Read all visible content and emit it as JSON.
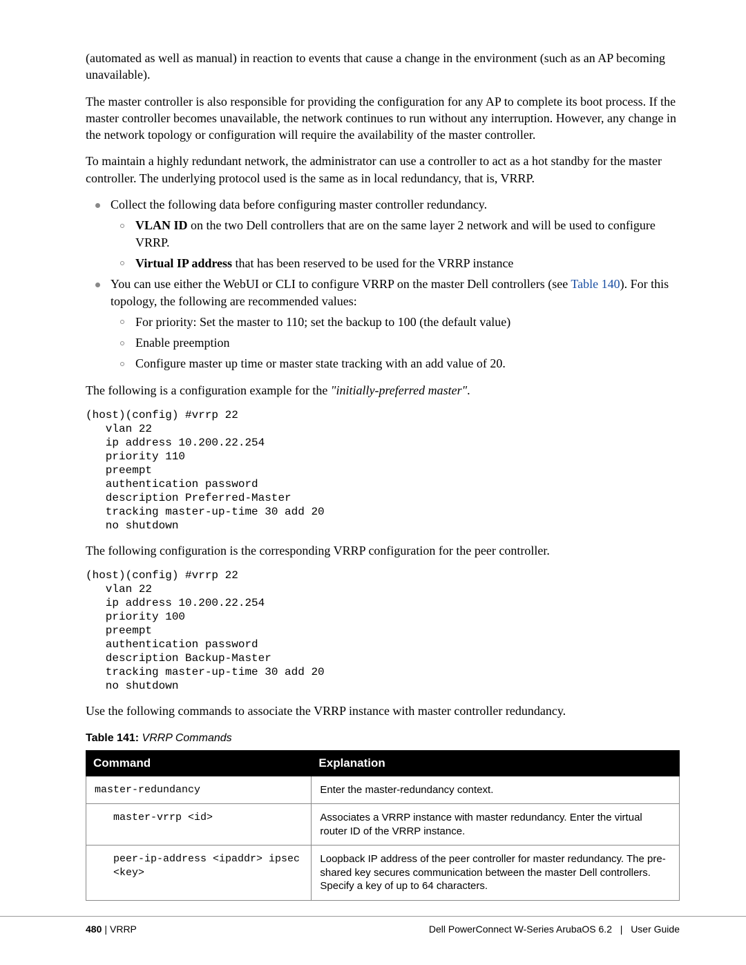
{
  "paragraphs": {
    "p1": "(automated as well as manual) in reaction to events that cause a change in the environment (such as an AP becoming unavailable).",
    "p2": "The master controller is also responsible for providing the configuration for any AP to complete its boot process. If the master controller becomes unavailable, the network continues to run without any interruption. However, any change in the network topology or configuration will require the availability of the master controller.",
    "p3": "To maintain a highly redundant network, the administrator can use a controller to act as a hot standby for the master controller. The underlying protocol used is the same as in local redundancy, that is, VRRP.",
    "p4_prefix": "The following is a configuration example for the ",
    "p4_italic": "\"initially-preferred master\"",
    "p4_suffix": ".",
    "p5": "The following configuration is the corresponding VRRP configuration for the peer controller.",
    "p6": "Use the following commands to associate the VRRP instance with master controller redundancy."
  },
  "bullets": {
    "b1": "Collect the following data before configuring master controller redundancy.",
    "b1a_bold": "VLAN ID",
    "b1a_rest": " on the two Dell controllers that are on the same layer 2 network and will be used to configure VRRP.",
    "b1b_bold": "Virtual IP address",
    "b1b_rest": " that has been reserved to be used for the VRRP instance",
    "b2_pre": "You can use either the WebUI or CLI to configure VRRP on the master Dell controllers (see ",
    "b2_link": "Table 140",
    "b2_post": "). For this topology, the following are recommended values:",
    "b2a": "For priority: Set the master to 110; set the backup to 100 (the default value)",
    "b2b": "Enable preemption",
    "b2c": "Configure master up time or master state tracking with an add value of 20."
  },
  "code1": "(host)(config) #vrrp 22\n   vlan 22\n   ip address 10.200.22.254\n   priority 110\n   preempt\n   authentication password\n   description Preferred-Master\n   tracking master-up-time 30 add 20\n   no shutdown",
  "code2": "(host)(config) #vrrp 22\n   vlan 22\n   ip address 10.200.22.254\n   priority 100\n   preempt\n   authentication password\n   description Backup-Master\n   tracking master-up-time 30 add 20\n   no shutdown",
  "table": {
    "caption_bold": "Table 141:",
    "caption_italic": " VRRP Commands",
    "headers": {
      "col1": "Command",
      "col2": "Explanation"
    },
    "rows": [
      {
        "cmd": "master-redundancy",
        "indent": 0,
        "explain": "Enter the master-redundancy context."
      },
      {
        "cmd": "master-vrrp <id>",
        "indent": 1,
        "explain": "Associates a VRRP instance with master redundancy. Enter the virtual router ID of the VRRP instance."
      },
      {
        "cmd": "peer-ip-address <ipaddr> ipsec\n<key>",
        "indent": 1,
        "explain": "Loopback IP address of the peer controller for master redundancy. The pre-shared key secures communication between the master Dell controllers. Specify a key of up to 64 characters."
      }
    ]
  },
  "footer": {
    "page_num": "480",
    "section": "VRRP",
    "product": "Dell PowerConnect W-Series ArubaOS 6.2",
    "doc": "User Guide"
  }
}
